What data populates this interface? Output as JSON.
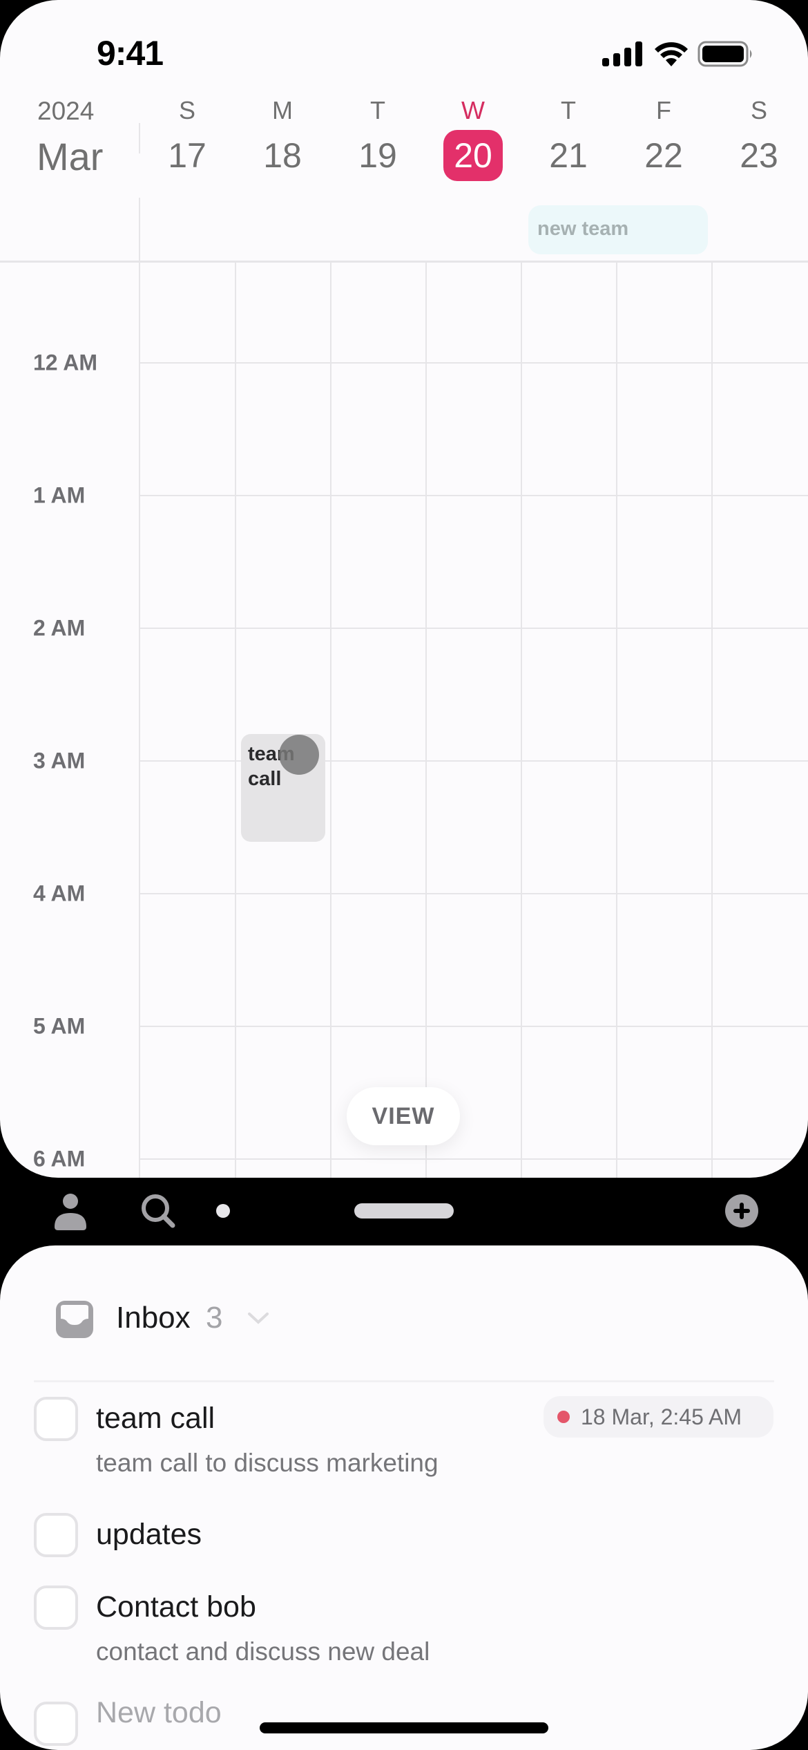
{
  "status_bar": {
    "time": "9:41",
    "icons": [
      "cellular-signal-icon",
      "wifi-icon",
      "battery-icon"
    ]
  },
  "calendar": {
    "year": "2024",
    "month": "Mar",
    "days": [
      {
        "letter": "S",
        "num": "17",
        "today": false
      },
      {
        "letter": "M",
        "num": "18",
        "today": false
      },
      {
        "letter": "T",
        "num": "19",
        "today": false
      },
      {
        "letter": "W",
        "num": "20",
        "today": true
      },
      {
        "letter": "T",
        "num": "21",
        "today": false
      },
      {
        "letter": "F",
        "num": "22",
        "today": false
      },
      {
        "letter": "S",
        "num": "23",
        "today": false
      }
    ],
    "all_day_events": [
      {
        "title": "new team",
        "day": "21"
      }
    ],
    "hours": [
      "12 AM",
      "1 AM",
      "2 AM",
      "3 AM",
      "4 AM",
      "5 AM",
      "6 AM"
    ],
    "events": [
      {
        "title": "team call",
        "day": "18"
      }
    ],
    "view_button": "VIEW",
    "colors": {
      "today": "#e3306a",
      "all_day_bg": "#ecf8fa",
      "event_bg": "#e5e4e6"
    }
  },
  "toolbar": {
    "icons": [
      "person-icon",
      "search-icon",
      "dot-indicator",
      "drag-handle",
      "add-circle-icon"
    ]
  },
  "inbox": {
    "title": "Inbox",
    "count": "3",
    "todos": [
      {
        "title": "team call",
        "subtitle": "team call to discuss marketing",
        "date": "18 Mar, 2:45 AM"
      },
      {
        "title": "updates",
        "subtitle": ""
      },
      {
        "title": "Contact bob",
        "subtitle": "contact and discuss new deal"
      }
    ],
    "new_todo_placeholder": "New todo"
  }
}
